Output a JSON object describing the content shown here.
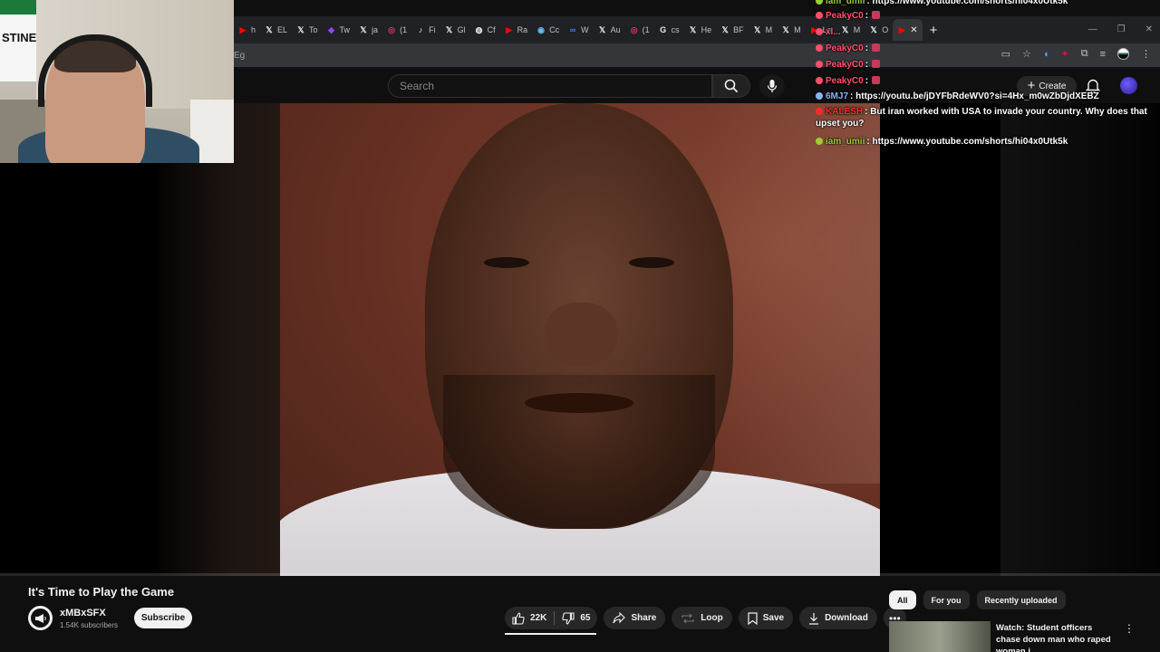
{
  "browser": {
    "tabs": [
      {
        "label": "h",
        "icon": "youtube-icon",
        "color": "#ff0000"
      },
      {
        "label": "EL",
        "icon": "x-icon",
        "color": "#e8eaed"
      },
      {
        "label": "To",
        "icon": "x-icon",
        "color": "#e8eaed"
      },
      {
        "label": "Tw",
        "icon": "twitch-icon",
        "color": "#9146ff"
      },
      {
        "label": "ja",
        "icon": "x-icon",
        "color": "#e8eaed"
      },
      {
        "label": "(1",
        "icon": "instagram-icon",
        "color": "#e1306c"
      },
      {
        "label": "Fi",
        "icon": "tiktok-icon",
        "color": "#e8eaed"
      },
      {
        "label": "Gl",
        "icon": "x-icon",
        "color": "#e8eaed"
      },
      {
        "label": "Cf",
        "icon": "globe-icon",
        "color": "#e8eaed"
      },
      {
        "label": "Ra",
        "icon": "youtube-icon",
        "color": "#ff0000"
      },
      {
        "label": "Cc",
        "icon": "steam-icon",
        "color": "#66c0f4"
      },
      {
        "label": "W",
        "icon": "go-icon",
        "color": "#4285f4"
      },
      {
        "label": "Au",
        "icon": "x-icon",
        "color": "#e8eaed"
      },
      {
        "label": "(1",
        "icon": "instagram-icon",
        "color": "#e1306c"
      },
      {
        "label": "cs",
        "icon": "google-icon",
        "color": "#e8eaed"
      },
      {
        "label": "He",
        "icon": "x-icon",
        "color": "#e8eaed"
      },
      {
        "label": "BF",
        "icon": "x-icon",
        "color": "#e8eaed"
      },
      {
        "label": "M",
        "icon": "x-icon",
        "color": "#e8eaed"
      },
      {
        "label": "M",
        "icon": "x-icon",
        "color": "#e8eaed"
      },
      {
        "label": "Lo",
        "icon": "youtube-icon",
        "color": "#ff0000"
      },
      {
        "label": "M",
        "icon": "x-icon",
        "color": "#e8eaed"
      },
      {
        "label": "O",
        "icon": "x-icon",
        "color": "#e8eaed"
      }
    ],
    "address_text": "Eg"
  },
  "youtube": {
    "search_placeholder": "Search",
    "create_label": "Create"
  },
  "video": {
    "title": "It's Time to Play the Game",
    "channel_name": "xMBxSFX",
    "subscribers": "1.54K subscribers",
    "subscribe_label": "Subscribe",
    "likes": "22K",
    "dislikes": "65",
    "share_label": "Share",
    "loop_label": "Loop",
    "save_label": "Save",
    "download_label": "Download"
  },
  "chips": [
    "All",
    "For you",
    "Recently uploaded"
  ],
  "recommendation": {
    "title": "Watch: Student officers chase down man who raped woman i"
  },
  "webcam": {
    "flag_text": "STINE"
  },
  "chat": [
    {
      "user": "iam_umii",
      "color": "#9acd32",
      "text": ": https://www.youtube.com/shorts/hi04x0Utk5k"
    },
    {
      "user": "PeakyC0",
      "color": "#ff4f6d",
      "text": ":"
    },
    {
      "user": "xl...",
      "color": "#ff4f6d",
      "text": ""
    },
    {
      "user": "PeakyC0",
      "color": "#ff4f6d",
      "text": ":"
    },
    {
      "user": "PeakyC0",
      "color": "#ff4f6d",
      "text": ":"
    },
    {
      "user": "PeakyC0",
      "color": "#ff4f6d",
      "text": ":"
    },
    {
      "user": "6MJ7",
      "color": "#8ab4f8",
      "text": ": https://youtu.be/jDYFbRdeWV0?si=4Hx_m0wZbDjdXEBZ"
    },
    {
      "user": "KALESH",
      "color": "#ff2a2a",
      "text": ": But iran worked with USA to invade your country. Why does that upset you?"
    },
    {
      "user": "iam_umii",
      "color": "#9acd32",
      "text": ": https://www.youtube.com/shorts/hi04x0Utk5k"
    }
  ]
}
